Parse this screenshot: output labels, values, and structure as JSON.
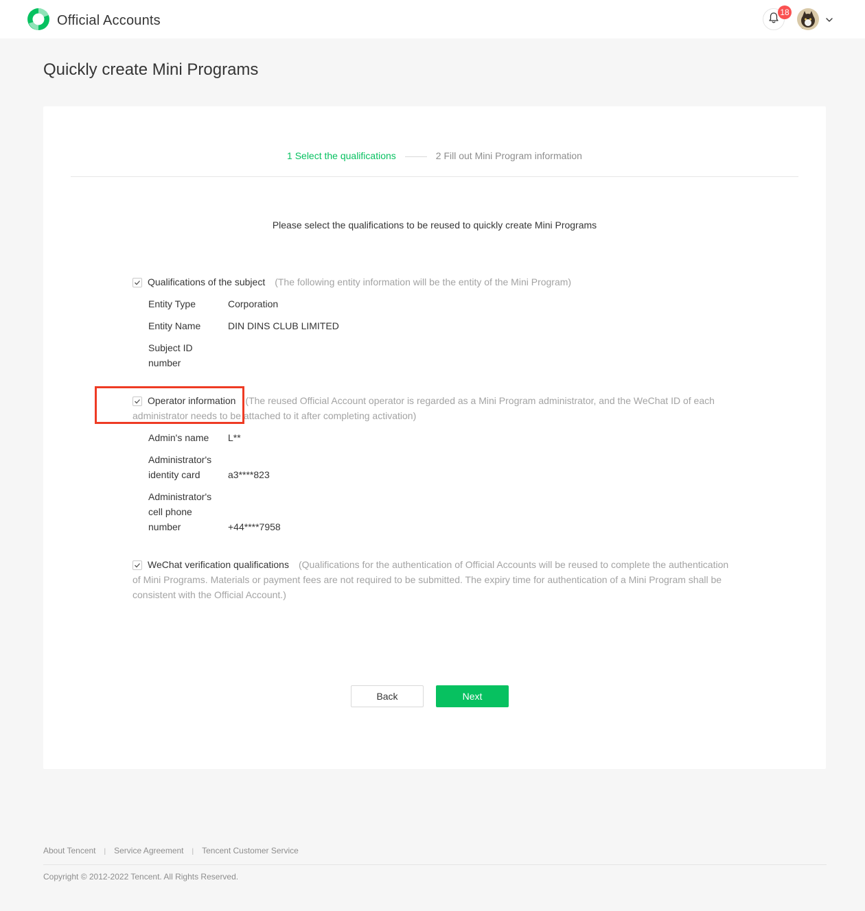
{
  "header": {
    "app_name": "Official Accounts",
    "notification_count": "18",
    "logo_icon": "wechat-official-accounts-logo",
    "bell_icon": "bell-icon",
    "menu_icon": "chevron-down-icon"
  },
  "page": {
    "title": "Quickly create Mini Programs"
  },
  "steps": [
    {
      "label": "1 Select the qualifications",
      "active": true
    },
    {
      "label": "2 Fill out Mini Program information",
      "active": false
    }
  ],
  "instruction": "Please select the qualifications to be reused to quickly create Mini Programs",
  "sections": {
    "subject": {
      "title": "Qualifications of the subject",
      "note": "(The following entity information will be the entity of the Mini Program)",
      "checked": true,
      "rows": [
        {
          "label": "Entity Type",
          "value": "Corporation"
        },
        {
          "label": "Entity Name",
          "value": "DIN DINS CLUB LIMITED"
        },
        {
          "label": "Subject ID number",
          "value": ""
        }
      ]
    },
    "operator": {
      "title": "Operator information",
      "note": "(The reused Official Account operator is regarded as a Mini Program administrator, and the WeChat ID of each administrator needs to be attached to it after completing activation)",
      "checked": true,
      "rows": [
        {
          "label": "Admin's name",
          "value": "L**"
        },
        {
          "label": "Administrator's identity card",
          "value": "a3****823"
        },
        {
          "label": "Administrator's cell phone number",
          "value": "+44****7958"
        }
      ]
    },
    "verification": {
      "title": "WeChat verification qualifications",
      "note": "(Qualifications for the authentication of Official Accounts will be reused to complete the authentication of Mini Programs. Materials or payment fees are not required to be submitted. The expiry time for authentication of a Mini Program shall be consistent with the Official Account.)",
      "checked": true
    }
  },
  "buttons": {
    "back": "Back",
    "next": "Next"
  },
  "footer": {
    "links": [
      "About Tencent",
      "Service Agreement",
      "Tencent Customer Service"
    ],
    "separator": "|",
    "copyright": "Copyright © 2012-2022 Tencent. All Rights Reserved."
  },
  "colors": {
    "brand_green": "#07c160",
    "badge_red": "#fa5151",
    "highlight_red": "#ee3b24"
  }
}
